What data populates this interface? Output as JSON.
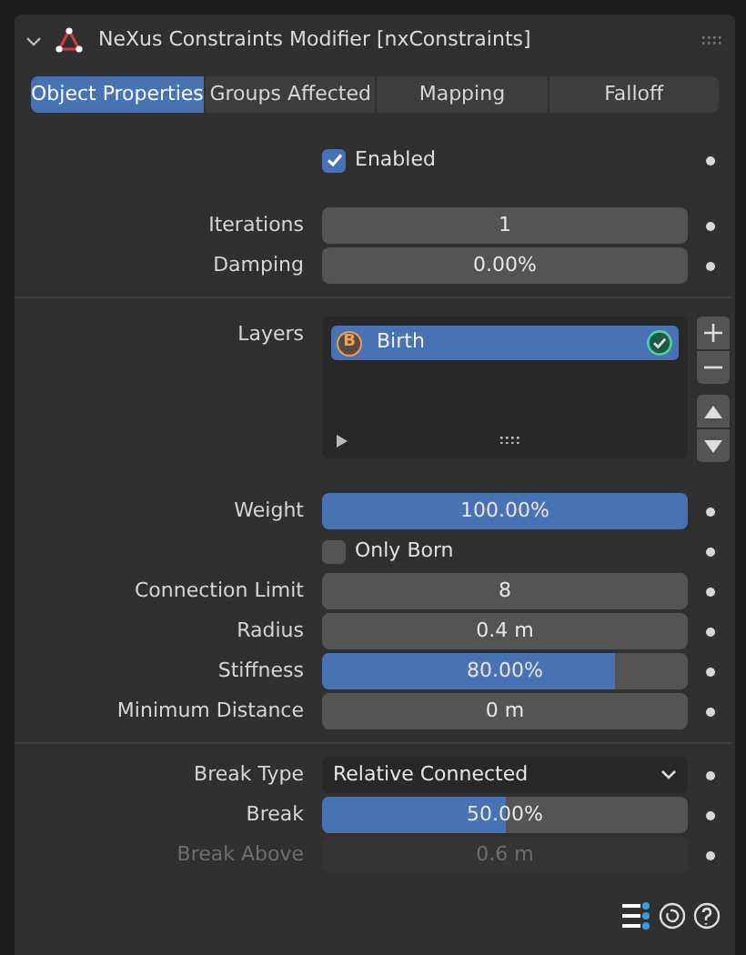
{
  "panel": {
    "title": "NeXus Constraints Modifier [nxConstraints]",
    "expanded": true
  },
  "tabs": [
    {
      "label": "Object Properties",
      "selected": true
    },
    {
      "label": "Groups Affected",
      "selected": false
    },
    {
      "label": "Mapping",
      "selected": false
    },
    {
      "label": "Falloff",
      "selected": false
    }
  ],
  "sections": [
    {
      "divider_above": false,
      "rows": [
        {
          "kind": "checkbox",
          "label": "Enabled",
          "checked": true
        }
      ]
    },
    {
      "divider_above": false,
      "rows": [
        {
          "kind": "number",
          "label": "Iterations",
          "value": "1",
          "disabled": false
        },
        {
          "kind": "number",
          "label": "Damping",
          "value": "0.00%",
          "disabled": false
        }
      ]
    },
    {
      "divider_above": true,
      "rows": [
        {
          "kind": "list",
          "label": "Layers",
          "items": [
            {
              "badge": "B",
              "name": "Birth",
              "selected": true,
              "enabled": true
            }
          ]
        },
        {
          "kind": "slider",
          "label": "Weight",
          "value": "100.00%",
          "level": 1
        },
        {
          "kind": "checkbox",
          "label": "Only Born",
          "checked": false
        },
        {
          "kind": "number",
          "label": "Connection Limit",
          "value": "8",
          "disabled": false
        },
        {
          "kind": "number",
          "label": "Radius",
          "value": "0.4 m",
          "disabled": false
        },
        {
          "kind": "slider",
          "label": "Stiffness",
          "value": "80.00%",
          "level": 0.8
        },
        {
          "kind": "number",
          "label": "Minimum Distance",
          "value": "0 m",
          "disabled": false
        }
      ]
    },
    {
      "divider_above": true,
      "rows": [
        {
          "kind": "dropdown",
          "label": "Break Type",
          "value": "Relative Connected"
        },
        {
          "kind": "slider",
          "label": "Break",
          "value": "50.00%",
          "level": 0.5
        },
        {
          "kind": "number",
          "label": "Break Above",
          "value": "0.6 m",
          "disabled": true
        }
      ]
    }
  ]
}
